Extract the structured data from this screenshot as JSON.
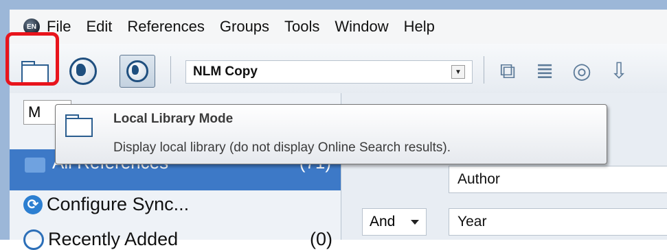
{
  "menubar": {
    "app_icon_text": "EN",
    "items": [
      "File",
      "Edit",
      "References",
      "Groups",
      "Tools",
      "Window",
      "Help"
    ]
  },
  "toolbar": {
    "style_select": {
      "value": "NLM Copy"
    },
    "buttons": [
      {
        "name": "local-library-mode",
        "icon": "folder-icon",
        "highlighted": true
      },
      {
        "name": "online-search-mode",
        "icon": "globe-icon"
      },
      {
        "name": "integrated-library-mode",
        "icon": "globe-in-box-icon",
        "pressed": true
      }
    ],
    "right_icons": [
      "copy-formatted-icon",
      "new-reference-icon",
      "online-search-icon",
      "import-icon"
    ]
  },
  "leftpanel": {
    "mode_tab_label": "M",
    "selected": {
      "label": "All References",
      "count": "(71)"
    },
    "configure_sync": "Configure Sync...",
    "recently_added": {
      "label": "Recently Added",
      "count": "(0)"
    }
  },
  "rightpanel": {
    "field1": "Author",
    "bool_op": "And",
    "field2": "Year"
  },
  "tooltip": {
    "title": "Local Library Mode",
    "description": "Display local library (do not display Online Search results)."
  },
  "colors": {
    "highlight_box": "#e8141c",
    "selection": "#3d79c7"
  }
}
